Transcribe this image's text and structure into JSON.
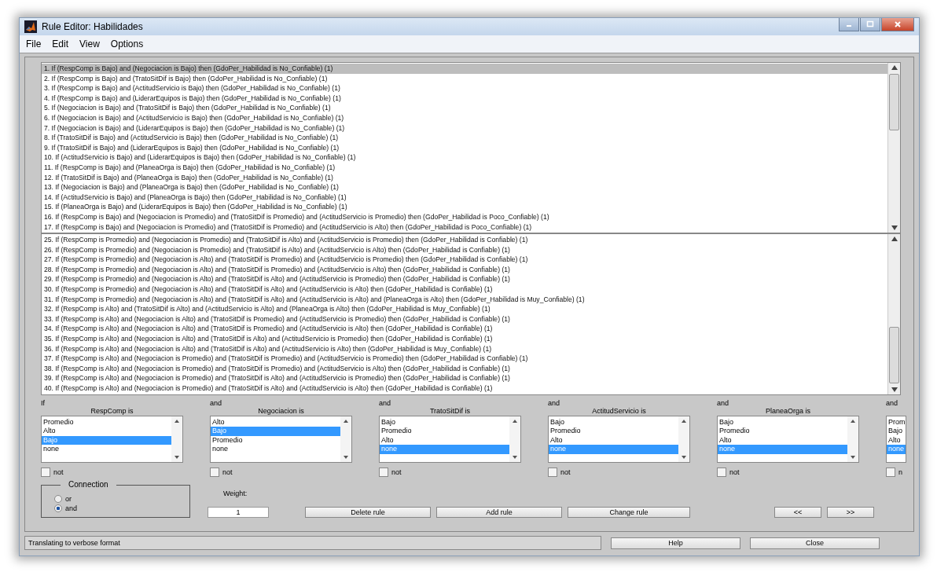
{
  "window": {
    "title": "Rule Editor: Habilidades"
  },
  "menu": [
    "File",
    "Edit",
    "View",
    "Options"
  ],
  "rule_lists": [
    {
      "rules": [
        {
          "text": "1. If (RespComp is Bajo) and (Negociacion is Bajo) then (GdoPer_Habilidad is No_Confiable) (1)",
          "selected": true
        },
        {
          "text": "2. If (RespComp is Bajo) and (TratoSitDif is Bajo) then (GdoPer_Habilidad is No_Confiable) (1)",
          "selected": false
        },
        {
          "text": "3. If (RespComp is Bajo) and (ActitudServicio is Bajo) then (GdoPer_Habilidad is No_Confiable) (1)",
          "selected": false
        },
        {
          "text": "4. If (RespComp is Bajo) and (LiderarEquipos is Bajo) then (GdoPer_Habilidad is No_Confiable) (1)",
          "selected": false
        },
        {
          "text": "5. If (Negociacion is Bajo) and (TratoSitDif is Bajo) then (GdoPer_Habilidad is No_Confiable) (1)",
          "selected": false
        },
        {
          "text": "6. If (Negociacion is Bajo) and (ActitudServicio is Bajo) then (GdoPer_Habilidad is No_Confiable) (1)",
          "selected": false
        },
        {
          "text": "7. If (Negociacion is Bajo) and (LiderarEquipos is Bajo) then (GdoPer_Habilidad is No_Confiable) (1)",
          "selected": false
        },
        {
          "text": "8. If (TratoSitDif is Bajo) and (ActitudServicio is Bajo) then (GdoPer_Habilidad is No_Confiable) (1)",
          "selected": false
        },
        {
          "text": "9. If (TratoSitDif is Bajo) and (LiderarEquipos is Bajo) then (GdoPer_Habilidad is No_Confiable) (1)",
          "selected": false
        },
        {
          "text": "10. If (ActitudServicio is Bajo) and (LiderarEquipos is Bajo) then (GdoPer_Habilidad is No_Confiable) (1)",
          "selected": false
        },
        {
          "text": "11. If (RespComp is Bajo) and (PlaneaOrga is Bajo) then (GdoPer_Habilidad is No_Confiable) (1)",
          "selected": false
        },
        {
          "text": "12. If (TratoSitDif is Bajo) and (PlaneaOrga is Bajo) then (GdoPer_Habilidad is No_Confiable) (1)",
          "selected": false
        },
        {
          "text": "13. If (Negociacion is Bajo) and (PlaneaOrga is Bajo) then (GdoPer_Habilidad is No_Confiable) (1)",
          "selected": false
        },
        {
          "text": "14. If (ActitudServicio is Bajo) and (PlaneaOrga is Bajo) then (GdoPer_Habilidad is No_Confiable) (1)",
          "selected": false
        },
        {
          "text": "15. If (PlaneaOrga is Bajo) and (LiderarEquipos is Bajo) then (GdoPer_Habilidad is No_Confiable) (1)",
          "selected": false
        },
        {
          "text": "16. If (RespComp is Bajo) and (Negociacion is Promedio) and (TratoSitDif is Promedio) and (ActitudServicio is Promedio) then (GdoPer_Habilidad is Poco_Confiable) (1)",
          "selected": false
        },
        {
          "text": "17. If (RespComp is Bajo) and (Negociacion is Promedio) and (TratoSitDif is Promedio) and (ActitudServicio is Alto) then (GdoPer_Habilidad is Poco_Confiable) (1)",
          "selected": false
        }
      ]
    },
    {
      "rules": [
        {
          "text": "25. If (RespComp is Promedio) and (Negociacion is Promedio) and (TratoSitDif is Alto) and (ActitudServicio is Promedio) then (GdoPer_Habilidad is Confiable) (1)",
          "selected": false
        },
        {
          "text": "26. If (RespComp is Promedio) and (Negociacion is Promedio) and (TratoSitDif is Alto) and (ActitudServicio is Alto) then (GdoPer_Habilidad is Confiable) (1)",
          "selected": false
        },
        {
          "text": "27. If (RespComp is Promedio) and (Negociacion is Alto) and (TratoSitDif is Promedio) and (ActitudServicio is Promedio) then (GdoPer_Habilidad is Confiable) (1)",
          "selected": false
        },
        {
          "text": "28. If (RespComp is Promedio) and (Negociacion is Alto) and (TratoSitDif is Promedio) and (ActitudServicio is Alto) then (GdoPer_Habilidad is Confiable) (1)",
          "selected": false
        },
        {
          "text": "29. If (RespComp is Promedio) and (Negociacion is Alto) and (TratoSitDif is Alto) and (ActitudServicio is Promedio) then (GdoPer_Habilidad is Confiable) (1)",
          "selected": false
        },
        {
          "text": "30. If (RespComp is Promedio) and (Negociacion is Alto) and (TratoSitDif is Alto) and (ActitudServicio is Alto) then (GdoPer_Habilidad is Confiable) (1)",
          "selected": false
        },
        {
          "text": "31. If (RespComp is Promedio) and (Negociacion is Alto) and (TratoSitDif is Alto) and (ActitudServicio is Alto) and (PlaneaOrga is Alto) then (GdoPer_Habilidad is Muy_Confiable) (1)",
          "selected": false
        },
        {
          "text": "32. If (RespComp is Alto) and (TratoSitDif is Alto) and (ActitudServicio is Alto) and (PlaneaOrga is Alto) then (GdoPer_Habilidad is Muy_Confiable) (1)",
          "selected": false
        },
        {
          "text": "33. If (RespComp is Alto) and (Negociacion is Alto) and (TratoSitDif is Promedio) and (ActitudServicio is Promedio) then (GdoPer_Habilidad is Confiable) (1)",
          "selected": false
        },
        {
          "text": "34. If (RespComp is Alto) and (Negociacion is Alto) and (TratoSitDif is Promedio) and (ActitudServicio is Alto) then (GdoPer_Habilidad is Confiable) (1)",
          "selected": false
        },
        {
          "text": "35. If (RespComp is Alto) and (Negociacion is Alto) and (TratoSitDif is Alto) and (ActitudServicio is Promedio) then (GdoPer_Habilidad is Confiable) (1)",
          "selected": false
        },
        {
          "text": "36. If (RespComp is Alto) and (Negociacion is Alto) and (TratoSitDif is Alto) and (ActitudServicio is Alto) then (GdoPer_Habilidad is Muy_Confiable) (1)",
          "selected": false
        },
        {
          "text": "37. If (RespComp is Alto) and (Negociacion is Promedio) and (TratoSitDif is Promedio) and (ActitudServicio is Promedio) then (GdoPer_Habilidad is Confiable) (1)",
          "selected": false
        },
        {
          "text": "38. If (RespComp is Alto) and (Negociacion is Promedio) and (TratoSitDif is Promedio) and (ActitudServicio is Alto) then (GdoPer_Habilidad is Confiable) (1)",
          "selected": false
        },
        {
          "text": "39. If (RespComp is Alto) and (Negociacion is Promedio) and (TratoSitDif is Alto) and (ActitudServicio is Promedio) then (GdoPer_Habilidad is Confiable) (1)",
          "selected": false
        },
        {
          "text": "40. If (RespComp is Alto) and (Negociacion is Promedio) and (TratoSitDif is Alto) and (ActitudServicio is Alto) then (GdoPer_Habilidad is Confiable) (1)",
          "selected": false
        }
      ]
    }
  ],
  "inputs": [
    {
      "connector": "If",
      "label": "RespComp is",
      "options": [
        {
          "text": "Promedio",
          "selected": false
        },
        {
          "text": "Alto",
          "selected": false
        },
        {
          "text": "Bajo",
          "selected": true
        },
        {
          "text": "none",
          "selected": false
        }
      ],
      "not_label": "not",
      "not_checked": false
    },
    {
      "connector": "and",
      "label": "Negociacion is",
      "options": [
        {
          "text": "Alto",
          "selected": false
        },
        {
          "text": "Bajo",
          "selected": true
        },
        {
          "text": "Promedio",
          "selected": false
        },
        {
          "text": "none",
          "selected": false
        }
      ],
      "not_label": "not",
      "not_checked": false
    },
    {
      "connector": "and",
      "label": "TratoSitDif is",
      "options": [
        {
          "text": "Bajo",
          "selected": false
        },
        {
          "text": "Promedio",
          "selected": false
        },
        {
          "text": "Alto",
          "selected": false
        },
        {
          "text": "none",
          "selected": true
        }
      ],
      "not_label": "not",
      "not_checked": false
    },
    {
      "connector": "and",
      "label": "ActitudServicio is",
      "options": [
        {
          "text": "Bajo",
          "selected": false
        },
        {
          "text": "Promedio",
          "selected": false
        },
        {
          "text": "Alto",
          "selected": false
        },
        {
          "text": "none",
          "selected": true
        }
      ],
      "not_label": "not",
      "not_checked": false
    },
    {
      "connector": "and",
      "label": "PlaneaOrga is",
      "options": [
        {
          "text": "Bajo",
          "selected": false
        },
        {
          "text": "Promedio",
          "selected": false
        },
        {
          "text": "Alto",
          "selected": false
        },
        {
          "text": "none",
          "selected": true
        }
      ],
      "not_label": "not",
      "not_checked": false
    },
    {
      "connector": "and",
      "options": [
        {
          "text": "Prom",
          "selected": false
        },
        {
          "text": "Bajo",
          "selected": false
        },
        {
          "text": "Alto",
          "selected": false
        },
        {
          "text": "none",
          "selected": true
        }
      ],
      "not_label": "n",
      "not_checked": false
    }
  ],
  "connection": {
    "title": "Connection",
    "options": [
      {
        "label": "or",
        "selected": false
      },
      {
        "label": "and",
        "selected": true
      }
    ]
  },
  "weight": {
    "label": "Weight:",
    "value": "1"
  },
  "buttons": [
    {
      "label": "Delete rule",
      "kind": "action"
    },
    {
      "label": "Add rule",
      "kind": "action"
    },
    {
      "label": "Change rule",
      "kind": "action"
    },
    {
      "label": "<<",
      "kind": "nav"
    },
    {
      "label": ">>",
      "kind": "nav"
    }
  ],
  "status": "Translating to verbose format",
  "footer_buttons": [
    "Help",
    "Close"
  ]
}
